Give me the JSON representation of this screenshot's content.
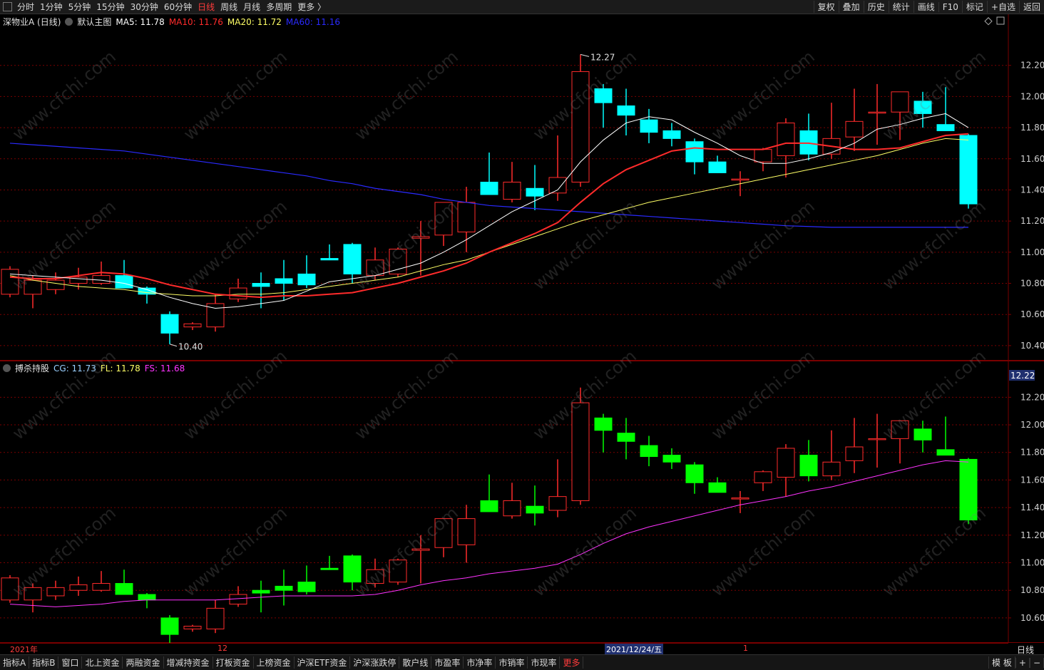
{
  "topbar": {
    "period_tabs": [
      "分时",
      "1分钟",
      "5分钟",
      "15分钟",
      "30分钟",
      "60分钟",
      "日线",
      "周线",
      "月线",
      "多周期",
      "更多 〉"
    ],
    "active_tab": "日线",
    "right_tools": [
      "复权",
      "叠加",
      "历史",
      "统计",
      "画线",
      "F10",
      "标记",
      "+自选",
      "返回"
    ]
  },
  "main_legend": {
    "stock": "深物业A (日线)",
    "template": "默认主图",
    "ma": [
      {
        "label": "MA5: 11.78",
        "color": "#ffffff"
      },
      {
        "label": "MA10: 11.76",
        "color": "#ff2b2b"
      },
      {
        "label": "MA20: 11.72",
        "color": "#ffff66"
      },
      {
        "label": "MA60: 11.16",
        "color": "#2a2aff"
      }
    ]
  },
  "indicator_legend": {
    "name": "搏杀持股",
    "items": [
      {
        "label": "CG: 11.73",
        "color": "#9ad0ff"
      },
      {
        "label": "FL: 11.78",
        "color": "#ffff66"
      },
      {
        "label": "FS: 11.68",
        "color": "#ff33ff"
      }
    ],
    "current_price_tag": "12.22"
  },
  "annotations": {
    "high": "12.27",
    "low": "10.40"
  },
  "chart_data": {
    "type": "candlestick",
    "y_ticks_main": [
      "12.20",
      "12.00",
      "11.80",
      "11.60",
      "11.40",
      "11.20",
      "11.00",
      "10.80",
      "10.60",
      "10.40"
    ],
    "y_ticks_indicator": [
      "12.20",
      "12.00",
      "11.80",
      "11.60",
      "11.40",
      "11.20",
      "11.00",
      "10.80",
      "10.60"
    ],
    "ylim_main": [
      10.34,
      12.4
    ],
    "ylim_indicator": [
      10.46,
      12.3
    ],
    "candles": [
      {
        "o": 10.73,
        "h": 10.91,
        "l": 10.71,
        "c": 10.89
      },
      {
        "o": 10.73,
        "h": 10.85,
        "l": 10.64,
        "c": 10.82
      },
      {
        "o": 10.76,
        "h": 10.87,
        "l": 10.73,
        "c": 10.82
      },
      {
        "o": 10.8,
        "h": 10.9,
        "l": 10.76,
        "c": 10.84
      },
      {
        "o": 10.8,
        "h": 10.94,
        "l": 10.79,
        "c": 10.85
      },
      {
        "o": 10.85,
        "h": 10.95,
        "l": 10.77,
        "c": 10.77
      },
      {
        "o": 10.77,
        "h": 10.78,
        "l": 10.67,
        "c": 10.73
      },
      {
        "o": 10.6,
        "h": 10.62,
        "l": 10.41,
        "c": 10.48
      },
      {
        "o": 10.52,
        "h": 10.55,
        "l": 10.5,
        "c": 10.54
      },
      {
        "o": 10.52,
        "h": 10.73,
        "l": 10.49,
        "c": 10.67
      },
      {
        "o": 10.7,
        "h": 10.83,
        "l": 10.68,
        "c": 10.77
      },
      {
        "o": 10.8,
        "h": 10.87,
        "l": 10.64,
        "c": 10.78
      },
      {
        "o": 10.83,
        "h": 10.95,
        "l": 10.69,
        "c": 10.8
      },
      {
        "o": 10.86,
        "h": 10.98,
        "l": 10.77,
        "c": 10.79
      },
      {
        "o": 10.96,
        "h": 11.05,
        "l": 10.95,
        "c": 10.95
      },
      {
        "o": 11.05,
        "h": 11.06,
        "l": 10.8,
        "c": 10.86
      },
      {
        "o": 10.85,
        "h": 11.03,
        "l": 10.82,
        "c": 10.95
      },
      {
        "o": 10.86,
        "h": 11.03,
        "l": 10.84,
        "c": 11.02
      },
      {
        "o": 11.09,
        "h": 11.2,
        "l": 10.85,
        "c": 11.1
      },
      {
        "o": 11.11,
        "h": 11.3,
        "l": 11.04,
        "c": 11.32
      },
      {
        "o": 11.13,
        "h": 11.42,
        "l": 11.0,
        "c": 11.32
      },
      {
        "o": 11.45,
        "h": 11.64,
        "l": 11.38,
        "c": 11.37
      },
      {
        "o": 11.34,
        "h": 11.58,
        "l": 11.32,
        "c": 11.45
      },
      {
        "o": 11.41,
        "h": 11.56,
        "l": 11.27,
        "c": 11.36
      },
      {
        "o": 11.38,
        "h": 11.75,
        "l": 11.33,
        "c": 11.48
      },
      {
        "o": 11.45,
        "h": 12.27,
        "l": 11.42,
        "c": 12.16
      },
      {
        "o": 12.05,
        "h": 12.08,
        "l": 11.8,
        "c": 11.96
      },
      {
        "o": 11.94,
        "h": 12.05,
        "l": 11.75,
        "c": 11.88
      },
      {
        "o": 11.85,
        "h": 11.92,
        "l": 11.7,
        "c": 11.77
      },
      {
        "o": 11.78,
        "h": 11.83,
        "l": 11.68,
        "c": 11.73
      },
      {
        "o": 11.71,
        "h": 11.73,
        "l": 11.5,
        "c": 11.58
      },
      {
        "o": 11.58,
        "h": 11.62,
        "l": 11.51,
        "c": 11.51
      },
      {
        "o": 11.47,
        "h": 11.52,
        "l": 11.36,
        "c": 11.47
      },
      {
        "o": 11.58,
        "h": 11.67,
        "l": 11.52,
        "c": 11.66
      },
      {
        "o": 11.62,
        "h": 11.86,
        "l": 11.48,
        "c": 11.83
      },
      {
        "o": 11.78,
        "h": 11.89,
        "l": 11.59,
        "c": 11.63
      },
      {
        "o": 11.63,
        "h": 11.96,
        "l": 11.6,
        "c": 11.73
      },
      {
        "o": 11.74,
        "h": 12.05,
        "l": 11.65,
        "c": 11.84
      },
      {
        "o": 11.9,
        "h": 12.08,
        "l": 11.69,
        "c": 11.9
      },
      {
        "o": 11.9,
        "h": 12.01,
        "l": 11.72,
        "c": 12.03
      },
      {
        "o": 11.97,
        "h": 12.03,
        "l": 11.8,
        "c": 11.89
      },
      {
        "o": 11.82,
        "h": 12.06,
        "l": 11.8,
        "c": 11.78
      },
      {
        "o": 11.75,
        "h": 11.76,
        "l": 11.28,
        "c": 11.31
      }
    ],
    "ma5": [
      10.86,
      10.85,
      10.84,
      10.83,
      10.82,
      10.8,
      10.76,
      10.71,
      10.67,
      10.64,
      10.65,
      10.67,
      10.69,
      10.75,
      10.81,
      10.83,
      10.85,
      10.89,
      10.93,
      11.0,
      11.08,
      11.17,
      11.26,
      11.33,
      11.4,
      11.58,
      11.72,
      11.83,
      11.87,
      11.85,
      11.77,
      11.7,
      11.62,
      11.57,
      11.57,
      11.6,
      11.64,
      11.7,
      11.79,
      11.82,
      11.86,
      11.89,
      11.8
    ],
    "ma10": [
      10.84,
      10.83,
      10.83,
      10.85,
      10.87,
      10.86,
      10.83,
      10.79,
      10.76,
      10.73,
      10.72,
      10.71,
      10.72,
      10.72,
      10.73,
      10.74,
      10.77,
      10.8,
      10.84,
      10.88,
      10.93,
      11.0,
      11.06,
      11.12,
      11.19,
      11.32,
      11.44,
      11.53,
      11.59,
      11.65,
      11.67,
      11.66,
      11.66,
      11.66,
      11.7,
      11.7,
      11.68,
      11.66,
      11.66,
      11.67,
      11.71,
      11.75,
      11.76
    ],
    "ma20": [
      10.85,
      10.82,
      10.8,
      10.78,
      10.77,
      10.76,
      10.74,
      10.73,
      10.72,
      10.72,
      10.73,
      10.73,
      10.74,
      10.76,
      10.78,
      10.8,
      10.82,
      10.84,
      10.88,
      10.92,
      10.95,
      11.0,
      11.05,
      11.1,
      11.15,
      11.2,
      11.24,
      11.28,
      11.32,
      11.35,
      11.38,
      11.41,
      11.44,
      11.47,
      11.5,
      11.53,
      11.56,
      11.59,
      11.62,
      11.66,
      11.7,
      11.73,
      11.72
    ],
    "ma60": [
      11.7,
      11.69,
      11.68,
      11.67,
      11.66,
      11.65,
      11.63,
      11.61,
      11.59,
      11.57,
      11.55,
      11.53,
      11.51,
      11.49,
      11.46,
      11.44,
      11.41,
      11.39,
      11.37,
      11.34,
      11.32,
      11.3,
      11.29,
      11.28,
      11.27,
      11.26,
      11.25,
      11.24,
      11.23,
      11.22,
      11.21,
      11.2,
      11.19,
      11.18,
      11.17,
      11.165,
      11.16,
      11.16,
      11.16,
      11.16,
      11.16,
      11.16,
      11.16
    ],
    "fs": [
      10.7,
      10.69,
      10.68,
      10.69,
      10.7,
      10.72,
      10.73,
      10.73,
      10.73,
      10.73,
      10.74,
      10.75,
      10.76,
      10.76,
      10.76,
      10.76,
      10.77,
      10.8,
      10.84,
      10.87,
      10.89,
      10.92,
      10.94,
      10.96,
      10.99,
      11.06,
      11.14,
      11.21,
      11.26,
      11.3,
      11.34,
      11.38,
      11.42,
      11.45,
      11.48,
      11.52,
      11.55,
      11.59,
      11.63,
      11.67,
      11.71,
      11.74,
      11.73
    ]
  },
  "date_axis": {
    "year": "2021年",
    "m12": "12",
    "cursor_date": "2021/12/24/五",
    "m1": "1",
    "period": "日线"
  },
  "bottom_tabs": [
    "指标A",
    "指标B",
    "窗口",
    "北上资金",
    "两融资金",
    "增减持资金",
    "打板资金",
    "上榜资金",
    "沪深ETF资金",
    "沪深涨跌停",
    "散户线",
    "市盈率",
    "市净率",
    "市销率",
    "市现率",
    "更多"
  ],
  "bottom_right": [
    "模 板",
    "+",
    "−"
  ],
  "watermark": "www.cfchi.com",
  "colors": {
    "up": "#ff2b2b",
    "down_main": "#00ffff",
    "down_ind": "#00ff00",
    "grid": "#7a0000",
    "axis_text": "#d0d0d0"
  }
}
